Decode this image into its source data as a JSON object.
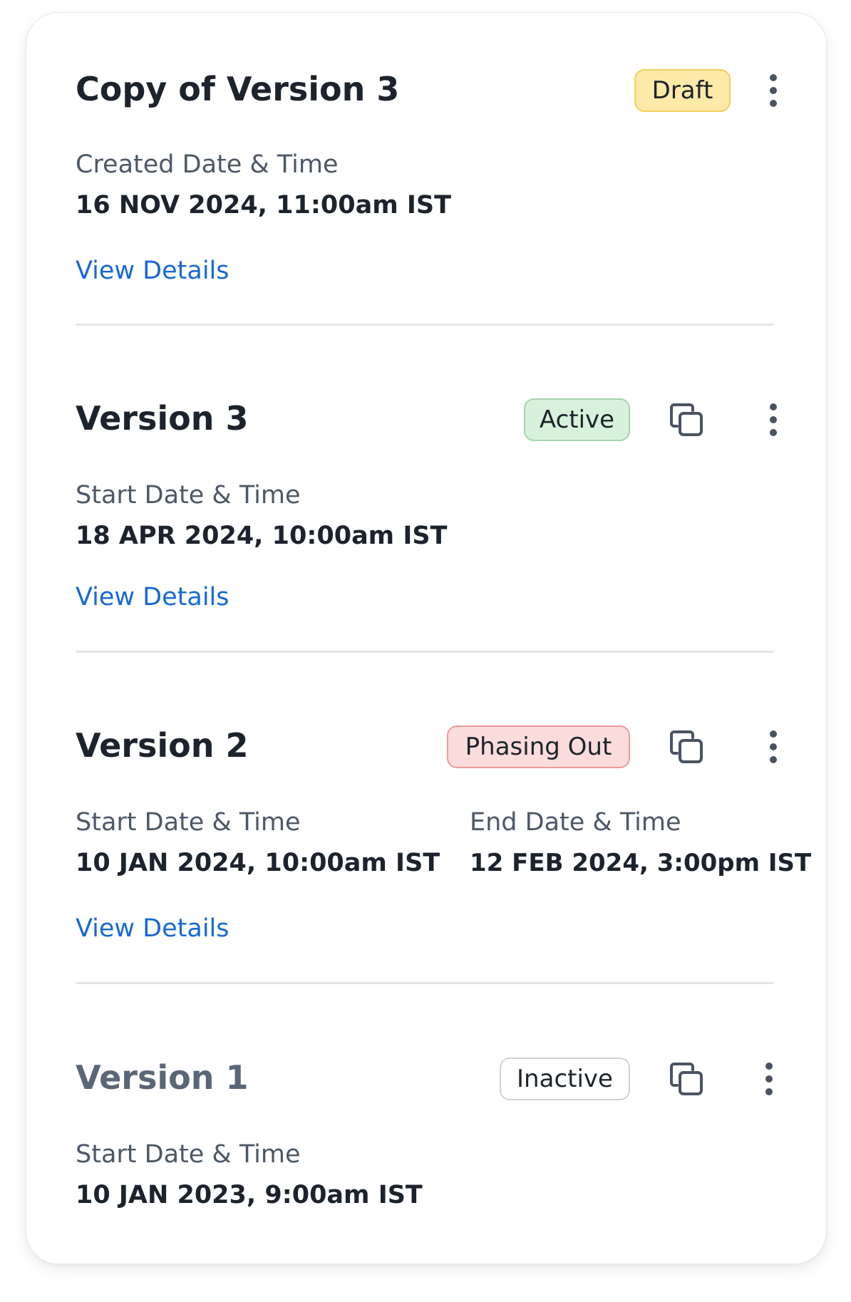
{
  "versions": [
    {
      "title": "Copy of Version 3",
      "status": "Draft",
      "fields": [
        {
          "label": "Created Date & Time",
          "value": "16 NOV 2024, 11:00am IST"
        }
      ],
      "link": "View Details"
    },
    {
      "title": "Version 3",
      "status": "Active",
      "fields": [
        {
          "label": "Start Date & Time",
          "value": "18 APR 2024, 10:00am IST"
        }
      ],
      "link": "View Details"
    },
    {
      "title": "Version 2",
      "status": "Phasing Out",
      "fields": [
        {
          "label": "Start Date & Time",
          "value": "10 JAN 2024, 10:00am IST"
        },
        {
          "label": "End Date & Time",
          "value": "12 FEB 2024, 3:00pm IST"
        }
      ],
      "link": "View Details"
    },
    {
      "title": "Version 1",
      "status": "Inactive",
      "fields": [
        {
          "label": "Start Date & Time",
          "value": "10 JAN 2023, 9:00am IST"
        }
      ]
    }
  ],
  "icons": {
    "copy": "copy-icon",
    "more": "more-vertical-icon"
  },
  "colors": {
    "draft": "#fde9a8",
    "active": "#d8f1dc",
    "phasing_out": "#fadcdc",
    "inactive": "#ffffff",
    "link": "#1769d6"
  }
}
